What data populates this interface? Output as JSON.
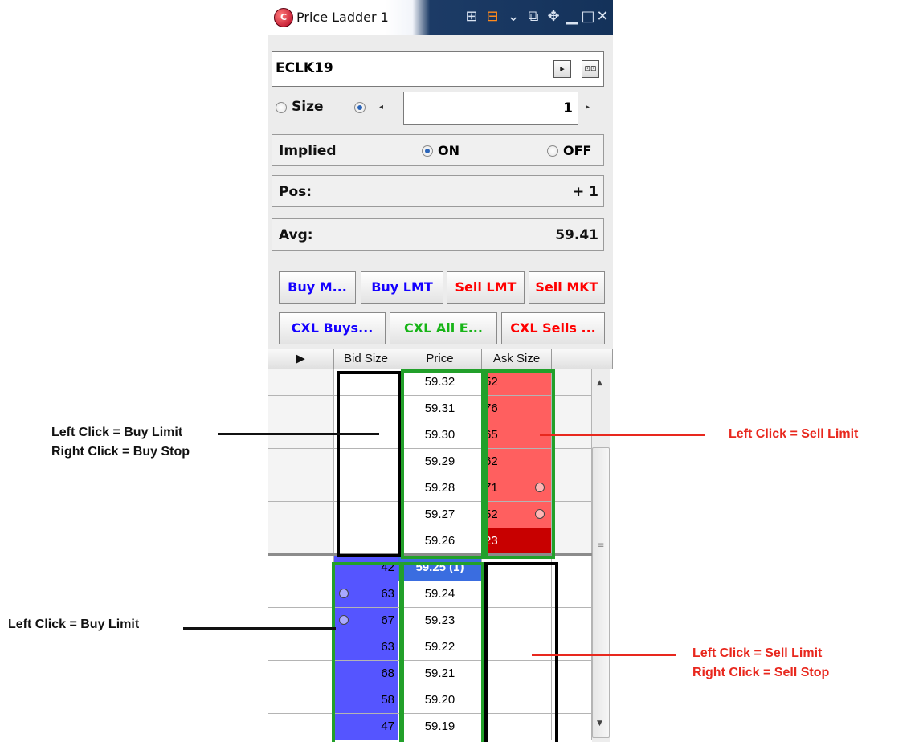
{
  "window": {
    "title": "Price Ladder 1",
    "symbol": "ECLK19",
    "size_label": "Size",
    "quantity": "1",
    "implied_label": "Implied",
    "implied_on": "ON",
    "implied_off": "OFF",
    "pos_label": "Pos:",
    "pos_value": "+ 1",
    "avg_label": "Avg:",
    "avg_value": "59.41"
  },
  "buttons": {
    "buy_market": "Buy M...",
    "buy_limit": "Buy LMT",
    "sell_limit": "Sell LMT",
    "sell_market": "Sell MKT",
    "cxl_buys": "CXL Buys...",
    "cxl_all": "CXL All E...",
    "cxl_sells": "CXL Sells ..."
  },
  "ladder": {
    "headers": {
      "bid": "Bid Size",
      "price": "Price",
      "ask": "Ask Size"
    },
    "rows": [
      {
        "price": "59.32",
        "bid": "",
        "ask": "52"
      },
      {
        "price": "59.31",
        "bid": "",
        "ask": "76"
      },
      {
        "price": "59.30",
        "bid": "",
        "ask": "65"
      },
      {
        "price": "59.29",
        "bid": "",
        "ask": "62"
      },
      {
        "price": "59.28",
        "bid": "",
        "ask": "71"
      },
      {
        "price": "59.27",
        "bid": "",
        "ask": "52"
      },
      {
        "price": "59.26",
        "bid": "",
        "ask": "23"
      },
      {
        "price": "59.25 (1)",
        "bid": "42",
        "ask": ""
      },
      {
        "price": "59.24",
        "bid": "63",
        "ask": ""
      },
      {
        "price": "59.23",
        "bid": "67",
        "ask": ""
      },
      {
        "price": "59.22",
        "bid": "63",
        "ask": ""
      },
      {
        "price": "59.21",
        "bid": "68",
        "ask": ""
      },
      {
        "price": "59.20",
        "bid": "58",
        "ask": ""
      },
      {
        "price": "59.19",
        "bid": "47",
        "ask": ""
      }
    ]
  },
  "annotations": {
    "top_left_line1": "Left Click = Buy Limit",
    "top_left_line2": "Right Click = Buy Stop",
    "top_right": "Left Click = Sell Limit",
    "bottom_left": "Left Click = Buy Limit",
    "bottom_right_line1": "Left Click = Sell Limit",
    "bottom_right_line2": "Right Click = Sell Stop"
  },
  "colors": {
    "ask_fill": "#ff5f5f",
    "best_ask": "#c80000",
    "bid_fill": "#5555ff",
    "inside_price": "#3a6de0",
    "buy_text": "#1400ff",
    "sell_text": "#ff0000",
    "cancel_all_text": "#17b417",
    "annotation_red": "#e8281e"
  }
}
